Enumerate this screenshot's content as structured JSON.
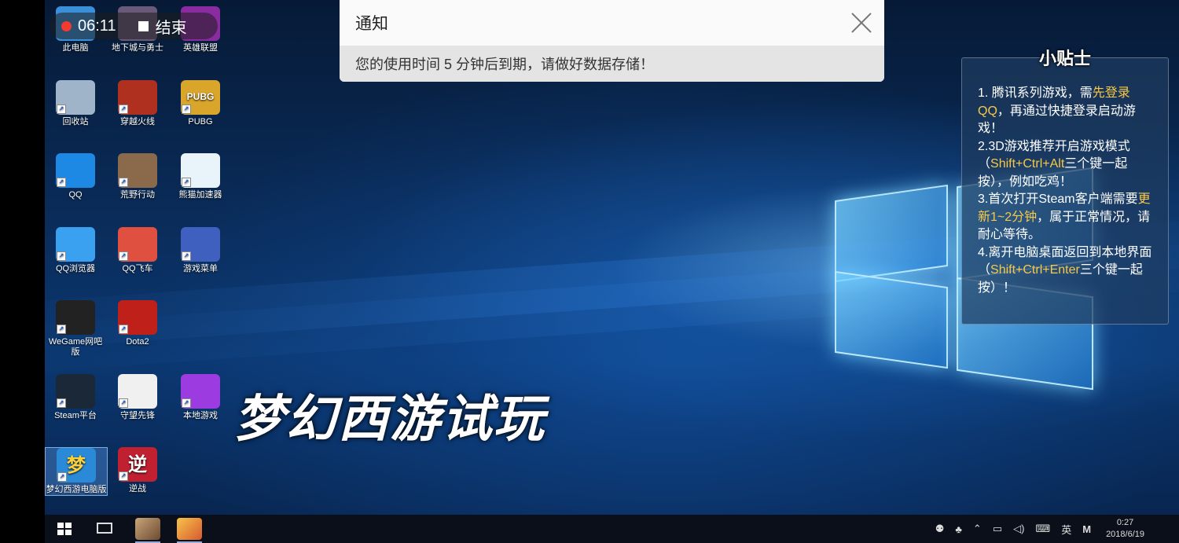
{
  "recording": {
    "time": "06:11",
    "stop_label": "结束"
  },
  "notification": {
    "title": "通知",
    "message": "您的使用时间 5 分钟后到期，请做好数据存储！"
  },
  "tips": {
    "title": "小贴士",
    "items": [
      {
        "parts": [
          "1. 腾讯系列游戏，需",
          "先登录QQ",
          "，再通过快捷登录启动游戏！"
        ]
      },
      {
        "parts": [
          "2.3D游戏推荐开启游戏模式（",
          "Shift+Ctrl+Alt",
          "三个键一起按），例如吃鸡！"
        ]
      },
      {
        "parts": [
          "3.首次打开Steam客户端需要",
          "更新1~2分钟",
          "，属于正常情况，请耐心等待。"
        ]
      },
      {
        "parts": [
          "4.离开电脑桌面返回到本地界面（",
          "Shift+Ctrl+Enter",
          "三个键一起按）！"
        ]
      }
    ]
  },
  "caption": "梦幻西游试玩",
  "desktop_icons": [
    {
      "label": "此电脑",
      "icon": "computer-icon",
      "color": "#3b8fd8"
    },
    {
      "label": "地下城与勇士",
      "icon": "dnf-icon",
      "color": "#6a5a7a"
    },
    {
      "label": "英雄联盟",
      "icon": "lol-icon",
      "color": "#8a2ba0"
    },
    {
      "label": "回收站",
      "icon": "recycle-bin-icon",
      "color": "#9fb4c8"
    },
    {
      "label": "穿越火线",
      "icon": "crossfire-icon",
      "color": "#b03020"
    },
    {
      "label": "PUBG",
      "icon": "pubg-icon",
      "color": "#d9a52a"
    },
    {
      "label": "QQ",
      "icon": "qq-icon",
      "color": "#1e88e5"
    },
    {
      "label": "荒野行动",
      "icon": "knives-out-icon",
      "color": "#8a6a4a"
    },
    {
      "label": "熊猫加速器",
      "icon": "panda-icon",
      "color": "#e8f4fa"
    },
    {
      "label": "QQ浏览器",
      "icon": "qq-browser-icon",
      "color": "#3aa0f0"
    },
    {
      "label": "QQ飞车",
      "icon": "qq-speed-icon",
      "color": "#e05040"
    },
    {
      "label": "游戏菜单",
      "icon": "game-menu-icon",
      "color": "#4060c0"
    },
    {
      "label": "WeGame网吧版",
      "icon": "wegame-icon",
      "color": "#222222"
    },
    {
      "label": "Dota2",
      "icon": "dota2-icon",
      "color": "#c0201a"
    },
    {
      "label": "Steam平台",
      "icon": "steam-icon",
      "color": "#1b2838"
    },
    {
      "label": "守望先锋",
      "icon": "overwatch-icon",
      "color": "#f0f0f0"
    },
    {
      "label": "本地游戏",
      "icon": "local-games-icon",
      "color": "#9c3be0"
    },
    {
      "label": "梦幻西游电脑版",
      "icon": "menghuan-icon",
      "color": "#2a8ad8"
    },
    {
      "label": "逆战",
      "icon": "nizhan-icon",
      "color": "#c02030"
    }
  ],
  "icon_glyphs": {
    "pubg": "PUBG",
    "menghuan": "梦",
    "nizhan": "逆"
  },
  "taskbar": {
    "tray_lang": "英",
    "tray_m": "M",
    "time": "0:27",
    "date": "2018/6/19"
  }
}
